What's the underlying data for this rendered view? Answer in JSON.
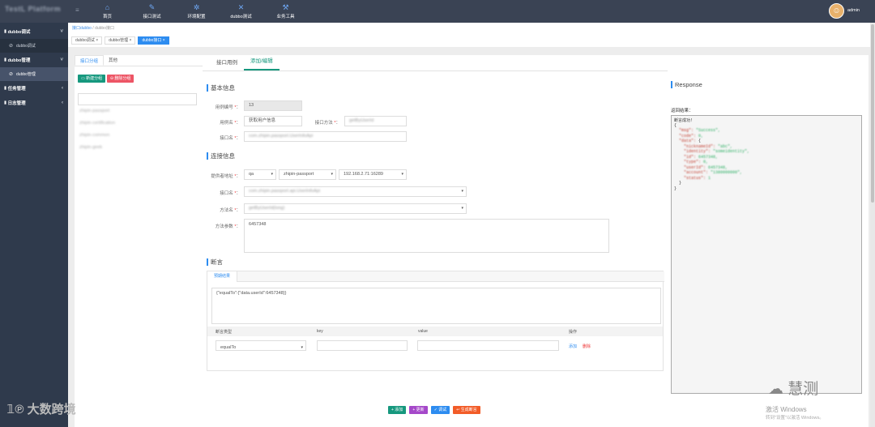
{
  "app": {
    "logo": "TestL Platform",
    "user": "admin"
  },
  "topnav": [
    {
      "label": "首页",
      "icon": "home-icon",
      "glyph": "⌂"
    },
    {
      "label": "接口测试",
      "icon": "edit-icon",
      "glyph": "✎"
    },
    {
      "label": "环境配置",
      "icon": "gear-icon",
      "glyph": "✲"
    },
    {
      "label": "dubbo测试",
      "icon": "tools-icon",
      "glyph": "✕"
    },
    {
      "label": "业务工具",
      "icon": "wrench-icon",
      "glyph": "⚒"
    }
  ],
  "sidebar": {
    "groups": [
      {
        "label": "dubbo调试",
        "sub": "dubbo调试"
      },
      {
        "label": "dubbo管理",
        "sub": "dubbo管理"
      },
      {
        "label": "任务管理"
      },
      {
        "label": "日志管理"
      }
    ]
  },
  "breadcrumb": {
    "root": "接口dubbo",
    "sep": "/",
    "current": "dubbo接口"
  },
  "tags": [
    "dubbo调试 ×",
    "dubbo管理 ×",
    "dubbo接口 ×"
  ],
  "left_panel": {
    "tabs": [
      "接口分组",
      "其他"
    ],
    "add_group": "新建分组",
    "del_group": "删除分组",
    "tree": [
      "zhipin-passport",
      "zhipin-certification",
      "zhipin-common",
      "zhipin-geek"
    ]
  },
  "mid": {
    "tabs": [
      "接口用例",
      "添加/编辑"
    ],
    "basic_title": "基本信息",
    "case_id_label": "用例编号",
    "case_id": "13",
    "case_name_label": "用例名",
    "case_name": "获取用户信息",
    "api_method_label": "接口方法",
    "api_method": "getByUserId",
    "api_name_label": "接口名",
    "api_name": "com.zhipin.passport.UserInfoApi",
    "conn_title": "连接信息",
    "provider_label": "提供者地址",
    "env": "qa",
    "app": "zhipin-passport",
    "ip": "192.168.2.71:16289",
    "iface_label": "接口名",
    "iface": "com.zhipin.passport.api.UserInfoApi",
    "method_label": "方法名",
    "method": "getByUserId(long)",
    "params_label": "方法参数",
    "params": "6457348",
    "assert_title": "断言",
    "assert_tab": "预期结果",
    "assert_expr": "{\"equalTo\":{\"data.userId\":6457348}}",
    "table_headers": [
      "断言类型",
      "key",
      "value",
      "操作"
    ],
    "assert_type": "equalTo",
    "add_link": "添加",
    "del_link": "删除"
  },
  "buttons": {
    "add": "+ 添加",
    "update": "+ 更新",
    "debug": "✓ 调试",
    "gen_assert": "↩ 生成断言"
  },
  "response": {
    "title": "Response",
    "result_label": "返回结果：",
    "status": "断言成功！"
  },
  "watermark": "大数跨境",
  "wechat": "慧测",
  "windows": "激活 Windows",
  "windows_sub": "转到\"设置\"以激活 Windows。"
}
